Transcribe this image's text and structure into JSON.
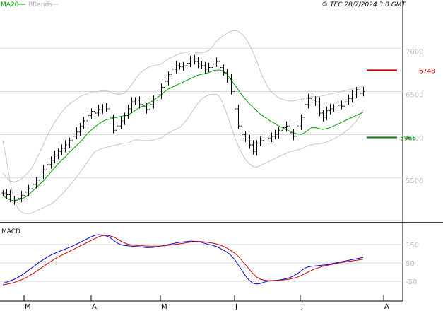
{
  "header": {
    "legend_ma": "MA20",
    "legend_bb": "BBands",
    "copyright": "© TEC 28/7/2024 3:0 GMT"
  },
  "colors": {
    "ma": "#00a000",
    "bbands": "#c4c4c4",
    "price_bar": "#000000",
    "macd_line": "#0000d0",
    "macd_signal": "#d00000",
    "resistance": "#cc0000",
    "support": "#008000",
    "grid": "#d6d6d6",
    "tick_text": "#bdbdbd"
  },
  "chart_data": [
    {
      "type": "ohlc",
      "name": "price",
      "yticks": [
        "7000",
        "6500",
        "6000",
        "5500"
      ],
      "ytick_values": [
        7000,
        6500,
        6000,
        5500
      ],
      "ylim": [
        5000,
        7450
      ],
      "x_labels": [
        "M",
        "A",
        "M",
        "J",
        "J",
        "A"
      ],
      "levels": [
        {
          "label": "6748",
          "value": 6748,
          "color": "#cc0000"
        },
        {
          "label": "5966",
          "value": 5966,
          "color": "#008000"
        }
      ],
      "closes": [
        5320,
        5300,
        5250,
        5230,
        5260,
        5290,
        5330,
        5370,
        5420,
        5470,
        5530,
        5590,
        5650,
        5700,
        5760,
        5800,
        5840,
        5880,
        5930,
        5980,
        6030,
        6100,
        6160,
        6220,
        6270,
        6250,
        6290,
        6320,
        6300,
        6200,
        6050,
        6100,
        6160,
        6220,
        6300,
        6380,
        6400,
        6350,
        6330,
        6290,
        6350,
        6400,
        6460,
        6550,
        6620,
        6700,
        6760,
        6800,
        6790,
        6800,
        6830,
        6880,
        6850,
        6820,
        6800,
        6760,
        6780,
        6820,
        6850,
        6780,
        6720,
        6650,
        6500,
        6300,
        6100,
        6000,
        5950,
        5880,
        5800,
        5900,
        5930,
        5950,
        5960,
        5980,
        6000,
        6050,
        6080,
        6100,
        6020,
        5980,
        6100,
        6200,
        6350,
        6420,
        6400,
        6380,
        6250,
        6200,
        6280,
        6300,
        6320,
        6340,
        6330,
        6380,
        6420,
        6460,
        6520,
        6480,
        6500
      ],
      "ma20": [
        5290,
        5260,
        5240,
        5230,
        5240,
        5250,
        5270,
        5300,
        5340,
        5380,
        5420,
        5460,
        5510,
        5560,
        5610,
        5660,
        5700,
        5740,
        5790,
        5830,
        5870,
        5910,
        5960,
        6010,
        6050,
        6090,
        6120,
        6150,
        6170,
        6180,
        6190,
        6200,
        6210,
        6220,
        6230,
        6250,
        6280,
        6310,
        6330,
        6350,
        6370,
        6400,
        6430,
        6460,
        6500,
        6530,
        6550,
        6570,
        6590,
        6610,
        6630,
        6650,
        6670,
        6690,
        6700,
        6710,
        6720,
        6740,
        6750,
        6750,
        6740,
        6700,
        6640,
        6580,
        6520,
        6460,
        6410,
        6360,
        6320,
        6280,
        6240,
        6210,
        6180,
        6150,
        6130,
        6100,
        6080,
        6060,
        6040,
        6020,
        6010,
        6000,
        6020,
        6050,
        6080,
        6080,
        6070,
        6060,
        6070,
        6080,
        6100,
        6120,
        6140,
        6160,
        6180,
        6200,
        6220,
        6240,
        6260
      ],
      "bb_upper": [
        5550,
        5500,
        5460,
        5450,
        5460,
        5480,
        5520,
        5560,
        5620,
        5700,
        5790,
        5880,
        5980,
        6060,
        6140,
        6200,
        6260,
        6310,
        6350,
        6380,
        6410,
        6440,
        6460,
        6480,
        6490,
        6500,
        6500,
        6510,
        6510,
        6500,
        6480,
        6470,
        6470,
        6480,
        6520,
        6580,
        6640,
        6700,
        6740,
        6770,
        6790,
        6800,
        6810,
        6820,
        6850,
        6880,
        6900,
        6920,
        6940,
        6950,
        6960,
        6960,
        6960,
        6950,
        6950,
        6960,
        6980,
        7020,
        7080,
        7120,
        7150,
        7180,
        7200,
        7210,
        7200,
        7170,
        7120,
        7050,
        6960,
        6860,
        6740,
        6640,
        6560,
        6500,
        6460,
        6430,
        6410,
        6400,
        6390,
        6390,
        6400,
        6410,
        6420,
        6430,
        6440,
        6440,
        6440,
        6450,
        6460,
        6470,
        6480,
        6490,
        6500,
        6510,
        6520,
        6530,
        6540,
        6550,
        6560
      ],
      "bb_lower": [
        5930,
        5700,
        5450,
        5250,
        5150,
        5100,
        5080,
        5080,
        5090,
        5110,
        5130,
        5150,
        5170,
        5190,
        5220,
        5260,
        5300,
        5350,
        5400,
        5450,
        5500,
        5560,
        5620,
        5680,
        5740,
        5800,
        5820,
        5840,
        5850,
        5860,
        5870,
        5880,
        5890,
        5900,
        5900,
        5920,
        5940,
        5940,
        5930,
        5930,
        5930,
        5940,
        5950,
        5960,
        5990,
        6020,
        6040,
        6060,
        6080,
        6120,
        6170,
        6230,
        6300,
        6360,
        6410,
        6440,
        6460,
        6470,
        6470,
        6440,
        6350,
        6230,
        6100,
        5980,
        5870,
        5780,
        5710,
        5660,
        5630,
        5620,
        5640,
        5660,
        5680,
        5700,
        5720,
        5740,
        5760,
        5780,
        5800,
        5810,
        5820,
        5830,
        5850,
        5870,
        5880,
        5890,
        5890,
        5900,
        5910,
        5930,
        5950,
        5970,
        6000,
        6030,
        6060,
        6100,
        6150,
        6210,
        6290
      ]
    },
    {
      "type": "line",
      "name": "MACD",
      "yticks": [
        "150",
        "50",
        "-50"
      ],
      "ytick_values": [
        150,
        50,
        -50
      ],
      "ylim": [
        -150,
        250
      ],
      "series": [
        {
          "values": [
            -60,
            -55,
            -48,
            -40,
            -30,
            -18,
            -5,
            10,
            25,
            40,
            55,
            68,
            80,
            92,
            102,
            110,
            118,
            126,
            134,
            142,
            152,
            162,
            172,
            182,
            192,
            200,
            204,
            202,
            198,
            190,
            175,
            160,
            150,
            145,
            143,
            142,
            140,
            138,
            136,
            134,
            134,
            135,
            138,
            142,
            146,
            150,
            154,
            158,
            162,
            164,
            166,
            168,
            168,
            166,
            162,
            156,
            150,
            146,
            140,
            130,
            120,
            108,
            92,
            70,
            40,
            10,
            -20,
            -45,
            -60,
            -65,
            -62,
            -55,
            -50,
            -48,
            -46,
            -44,
            -40,
            -36,
            -30,
            -22,
            -10,
            5,
            20,
            28,
            32,
            34,
            36,
            38,
            40,
            44,
            48,
            52,
            56,
            60,
            64,
            68,
            72,
            76,
            80
          ]
        },
        {
          "values": [
            -70,
            -66,
            -62,
            -57,
            -50,
            -42,
            -33,
            -22,
            -10,
            3,
            16,
            30,
            44,
            58,
            70,
            82,
            92,
            102,
            112,
            122,
            132,
            142,
            152,
            162,
            172,
            182,
            192,
            198,
            200,
            198,
            192,
            182,
            170,
            160,
            152,
            148,
            146,
            144,
            143,
            142,
            141,
            141,
            141,
            142,
            144,
            146,
            148,
            151,
            154,
            157,
            160,
            163,
            166,
            167,
            166,
            164,
            161,
            158,
            154,
            148,
            140,
            130,
            118,
            104,
            86,
            64,
            40,
            16,
            -8,
            -26,
            -38,
            -44,
            -46,
            -46,
            -45,
            -44,
            -43,
            -41,
            -38,
            -34,
            -28,
            -20,
            -10,
            0,
            10,
            18,
            25,
            31,
            36,
            40,
            44,
            48,
            52,
            55,
            58,
            61,
            64,
            67,
            70
          ]
        }
      ]
    }
  ]
}
